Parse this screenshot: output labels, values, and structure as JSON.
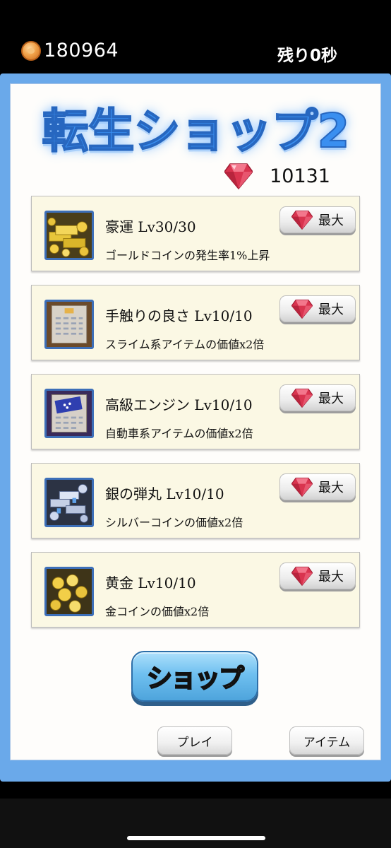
{
  "status_bar": {
    "coin_icon": "gold-coin-icon",
    "coins": "180964",
    "timer": "残り0秒"
  },
  "shop": {
    "title": "転生ショップ2",
    "gem_icon": "ruby-gem-icon",
    "gems": "10131",
    "items": [
      {
        "icon": "gold-bars-coins-icon",
        "name": "豪運 Lv30/30",
        "desc": "ゴールドコインの発生率1%上昇",
        "button": "最大"
      },
      {
        "icon": "circuit-board-icon",
        "name": "手触りの良さ Lv10/10",
        "desc": "スライム系アイテムの価値x2倍",
        "button": "最大"
      },
      {
        "icon": "engine-chip-icon",
        "name": "高級エンジン Lv10/10",
        "desc": "自動車系アイテムの価値x2倍",
        "button": "最大"
      },
      {
        "icon": "silver-coins-icon",
        "name": "銀の弾丸 Lv10/10",
        "desc": "シルバーコインの価値x2倍",
        "button": "最大"
      },
      {
        "icon": "gold-coins-icon",
        "name": "黄金 Lv10/10",
        "desc": "金コインの価値x2倍",
        "button": "最大"
      }
    ]
  },
  "buttons": {
    "shop": "ショップ",
    "play": "プレイ",
    "items": "アイテム"
  },
  "colors": {
    "frame": "#6aa9ea",
    "title": "#3a8ff0",
    "card": "#fbf8e4",
    "gem": "#d9344f"
  }
}
